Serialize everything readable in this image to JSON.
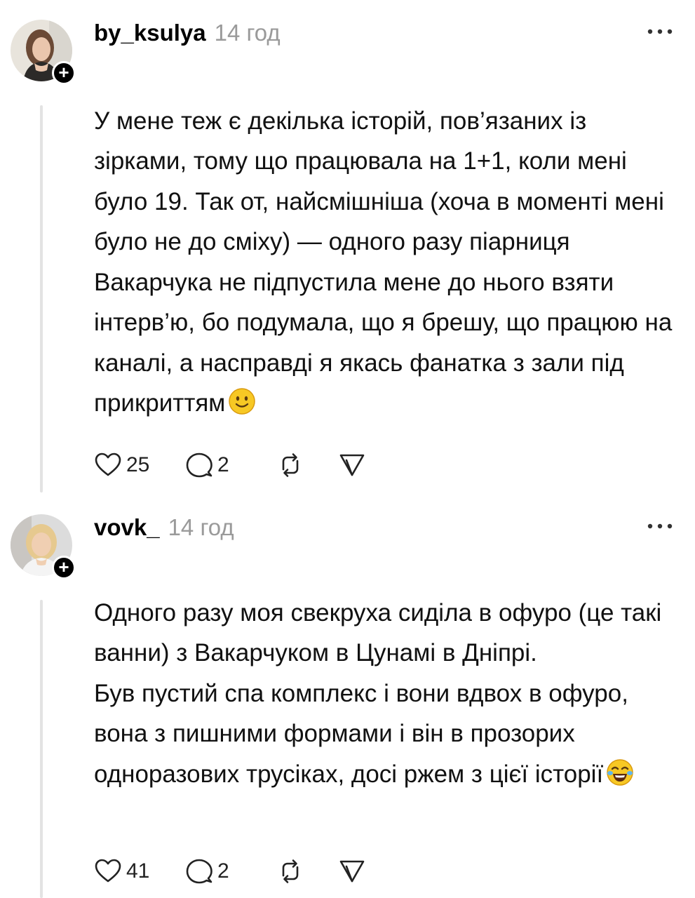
{
  "posts": [
    {
      "username": "by_ksulya",
      "time": "14 год",
      "text": "У мене теж є декілька історій, пов’язаних із зірками, тому що працювала на 1+1, коли мені було 19. Так от, найсмішніша (хоча в моменті мені було не до сміху) — одного разу піарниця Вакарчука не підпустила мене до нього взяти інтерв’ю, бо подумала, що я брешу, що працюю на каналі, а насправді я якась фанатка з зали під прикриттям",
      "emoji": "slightly-smiling-face",
      "likes": "25",
      "replies": "2"
    },
    {
      "username": "vovk_",
      "time": "14 год",
      "text": "Одного разу моя свекруха сиділа в офуро (це такі ванни) з Вакарчуком в Цунамі в Дніпрі.\nБув пустий спа комплекс і вони вдвох в офуро, вона з пишними формами і він в прозорих одноразових трусіках, досі ржем з цієї історії",
      "emoji": "face-with-tears-of-joy",
      "likes": "41",
      "replies": "2"
    }
  ],
  "icons": {
    "like": "heart-icon",
    "reply": "speech-bubble-icon",
    "repost": "repost-icon",
    "share": "send-icon",
    "more": "more-dots-icon",
    "follow": "plus-icon"
  },
  "colors": {
    "text": "#111111",
    "muted": "#9a9a9a",
    "thread_line": "#e3e3e3",
    "badge": "#000000"
  }
}
